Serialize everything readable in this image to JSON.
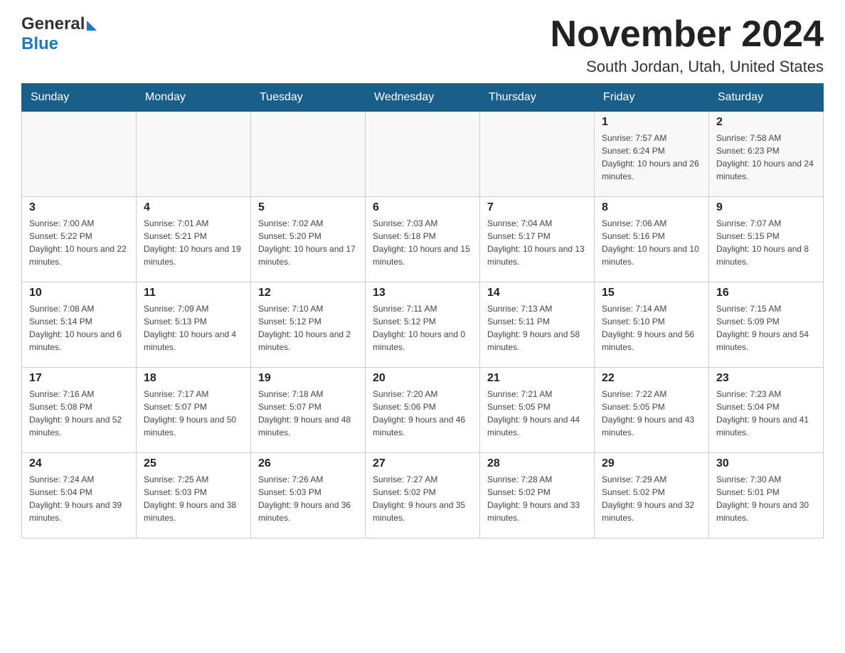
{
  "header": {
    "logo_general": "General",
    "logo_blue": "Blue",
    "title": "November 2024",
    "subtitle": "South Jordan, Utah, United States"
  },
  "weekdays": [
    "Sunday",
    "Monday",
    "Tuesday",
    "Wednesday",
    "Thursday",
    "Friday",
    "Saturday"
  ],
  "weeks": [
    [
      {
        "day": "",
        "sunrise": "",
        "sunset": "",
        "daylight": ""
      },
      {
        "day": "",
        "sunrise": "",
        "sunset": "",
        "daylight": ""
      },
      {
        "day": "",
        "sunrise": "",
        "sunset": "",
        "daylight": ""
      },
      {
        "day": "",
        "sunrise": "",
        "sunset": "",
        "daylight": ""
      },
      {
        "day": "",
        "sunrise": "",
        "sunset": "",
        "daylight": ""
      },
      {
        "day": "1",
        "sunrise": "Sunrise: 7:57 AM",
        "sunset": "Sunset: 6:24 PM",
        "daylight": "Daylight: 10 hours and 26 minutes."
      },
      {
        "day": "2",
        "sunrise": "Sunrise: 7:58 AM",
        "sunset": "Sunset: 6:23 PM",
        "daylight": "Daylight: 10 hours and 24 minutes."
      }
    ],
    [
      {
        "day": "3",
        "sunrise": "Sunrise: 7:00 AM",
        "sunset": "Sunset: 5:22 PM",
        "daylight": "Daylight: 10 hours and 22 minutes."
      },
      {
        "day": "4",
        "sunrise": "Sunrise: 7:01 AM",
        "sunset": "Sunset: 5:21 PM",
        "daylight": "Daylight: 10 hours and 19 minutes."
      },
      {
        "day": "5",
        "sunrise": "Sunrise: 7:02 AM",
        "sunset": "Sunset: 5:20 PM",
        "daylight": "Daylight: 10 hours and 17 minutes."
      },
      {
        "day": "6",
        "sunrise": "Sunrise: 7:03 AM",
        "sunset": "Sunset: 5:18 PM",
        "daylight": "Daylight: 10 hours and 15 minutes."
      },
      {
        "day": "7",
        "sunrise": "Sunrise: 7:04 AM",
        "sunset": "Sunset: 5:17 PM",
        "daylight": "Daylight: 10 hours and 13 minutes."
      },
      {
        "day": "8",
        "sunrise": "Sunrise: 7:06 AM",
        "sunset": "Sunset: 5:16 PM",
        "daylight": "Daylight: 10 hours and 10 minutes."
      },
      {
        "day": "9",
        "sunrise": "Sunrise: 7:07 AM",
        "sunset": "Sunset: 5:15 PM",
        "daylight": "Daylight: 10 hours and 8 minutes."
      }
    ],
    [
      {
        "day": "10",
        "sunrise": "Sunrise: 7:08 AM",
        "sunset": "Sunset: 5:14 PM",
        "daylight": "Daylight: 10 hours and 6 minutes."
      },
      {
        "day": "11",
        "sunrise": "Sunrise: 7:09 AM",
        "sunset": "Sunset: 5:13 PM",
        "daylight": "Daylight: 10 hours and 4 minutes."
      },
      {
        "day": "12",
        "sunrise": "Sunrise: 7:10 AM",
        "sunset": "Sunset: 5:12 PM",
        "daylight": "Daylight: 10 hours and 2 minutes."
      },
      {
        "day": "13",
        "sunrise": "Sunrise: 7:11 AM",
        "sunset": "Sunset: 5:12 PM",
        "daylight": "Daylight: 10 hours and 0 minutes."
      },
      {
        "day": "14",
        "sunrise": "Sunrise: 7:13 AM",
        "sunset": "Sunset: 5:11 PM",
        "daylight": "Daylight: 9 hours and 58 minutes."
      },
      {
        "day": "15",
        "sunrise": "Sunrise: 7:14 AM",
        "sunset": "Sunset: 5:10 PM",
        "daylight": "Daylight: 9 hours and 56 minutes."
      },
      {
        "day": "16",
        "sunrise": "Sunrise: 7:15 AM",
        "sunset": "Sunset: 5:09 PM",
        "daylight": "Daylight: 9 hours and 54 minutes."
      }
    ],
    [
      {
        "day": "17",
        "sunrise": "Sunrise: 7:16 AM",
        "sunset": "Sunset: 5:08 PM",
        "daylight": "Daylight: 9 hours and 52 minutes."
      },
      {
        "day": "18",
        "sunrise": "Sunrise: 7:17 AM",
        "sunset": "Sunset: 5:07 PM",
        "daylight": "Daylight: 9 hours and 50 minutes."
      },
      {
        "day": "19",
        "sunrise": "Sunrise: 7:18 AM",
        "sunset": "Sunset: 5:07 PM",
        "daylight": "Daylight: 9 hours and 48 minutes."
      },
      {
        "day": "20",
        "sunrise": "Sunrise: 7:20 AM",
        "sunset": "Sunset: 5:06 PM",
        "daylight": "Daylight: 9 hours and 46 minutes."
      },
      {
        "day": "21",
        "sunrise": "Sunrise: 7:21 AM",
        "sunset": "Sunset: 5:05 PM",
        "daylight": "Daylight: 9 hours and 44 minutes."
      },
      {
        "day": "22",
        "sunrise": "Sunrise: 7:22 AM",
        "sunset": "Sunset: 5:05 PM",
        "daylight": "Daylight: 9 hours and 43 minutes."
      },
      {
        "day": "23",
        "sunrise": "Sunrise: 7:23 AM",
        "sunset": "Sunset: 5:04 PM",
        "daylight": "Daylight: 9 hours and 41 minutes."
      }
    ],
    [
      {
        "day": "24",
        "sunrise": "Sunrise: 7:24 AM",
        "sunset": "Sunset: 5:04 PM",
        "daylight": "Daylight: 9 hours and 39 minutes."
      },
      {
        "day": "25",
        "sunrise": "Sunrise: 7:25 AM",
        "sunset": "Sunset: 5:03 PM",
        "daylight": "Daylight: 9 hours and 38 minutes."
      },
      {
        "day": "26",
        "sunrise": "Sunrise: 7:26 AM",
        "sunset": "Sunset: 5:03 PM",
        "daylight": "Daylight: 9 hours and 36 minutes."
      },
      {
        "day": "27",
        "sunrise": "Sunrise: 7:27 AM",
        "sunset": "Sunset: 5:02 PM",
        "daylight": "Daylight: 9 hours and 35 minutes."
      },
      {
        "day": "28",
        "sunrise": "Sunrise: 7:28 AM",
        "sunset": "Sunset: 5:02 PM",
        "daylight": "Daylight: 9 hours and 33 minutes."
      },
      {
        "day": "29",
        "sunrise": "Sunrise: 7:29 AM",
        "sunset": "Sunset: 5:02 PM",
        "daylight": "Daylight: 9 hours and 32 minutes."
      },
      {
        "day": "30",
        "sunrise": "Sunrise: 7:30 AM",
        "sunset": "Sunset: 5:01 PM",
        "daylight": "Daylight: 9 hours and 30 minutes."
      }
    ]
  ]
}
